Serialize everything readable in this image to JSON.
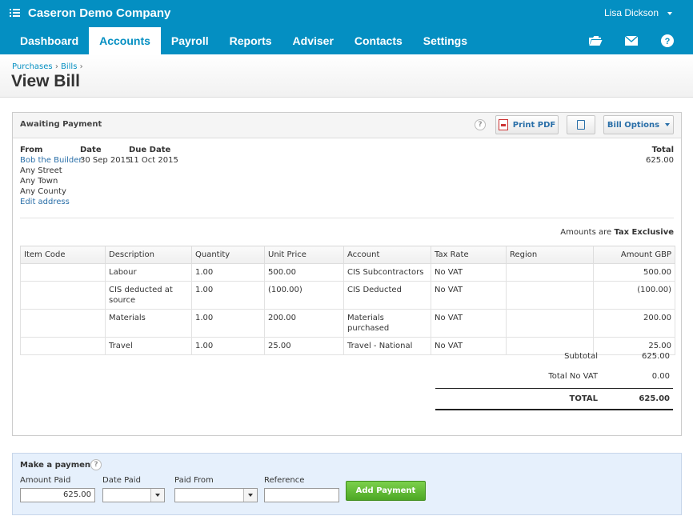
{
  "org": {
    "name": "Caseron Demo Company"
  },
  "user": {
    "name": "Lisa Dickson"
  },
  "nav": [
    {
      "label": "Dashboard"
    },
    {
      "label": "Accounts"
    },
    {
      "label": "Payroll"
    },
    {
      "label": "Reports"
    },
    {
      "label": "Adviser"
    },
    {
      "label": "Contacts"
    },
    {
      "label": "Settings"
    }
  ],
  "nav_icons": [
    "folder-icon",
    "mail-icon",
    "help-icon"
  ],
  "breadcrumb": {
    "first": "Purchases",
    "second": "Bills"
  },
  "page_title": "View Bill",
  "bill": {
    "status": "Awaiting Payment",
    "print_pdf_label": "Print PDF",
    "bill_options_label": "Bill Options",
    "from_label": "From",
    "from_name": "Bob the Builder",
    "address": [
      "Any Street",
      "Any Town",
      "Any County"
    ],
    "edit_address_label": "Edit address",
    "date_label": "Date",
    "date": "30 Sep 2015",
    "due_date_label": "Due Date",
    "due_date": "11 Oct 2015",
    "total_label": "Total",
    "total": "625.00",
    "amounts_prefix": "Amounts are",
    "amounts_mode": "Tax Exclusive",
    "columns": [
      "Item Code",
      "Description",
      "Quantity",
      "Unit Price",
      "Account",
      "Tax Rate",
      "Region",
      "Amount GBP"
    ],
    "lines": [
      {
        "item_code": "",
        "description": "Labour",
        "quantity": "1.00",
        "unit_price": "500.00",
        "account": "CIS Subcontractors",
        "tax_rate": "No VAT",
        "region": "",
        "amount": "500.00"
      },
      {
        "item_code": "",
        "description": "CIS deducted at source",
        "quantity": "1.00",
        "unit_price": "(100.00)",
        "account": "CIS Deducted",
        "tax_rate": "No VAT",
        "region": "",
        "amount": "(100.00)"
      },
      {
        "item_code": "",
        "description": "Materials",
        "quantity": "1.00",
        "unit_price": "200.00",
        "account": "Materials purchased",
        "tax_rate": "No VAT",
        "region": "",
        "amount": "200.00"
      },
      {
        "item_code": "",
        "description": "Travel",
        "quantity": "1.00",
        "unit_price": "25.00",
        "account": "Travel - National",
        "tax_rate": "No VAT",
        "region": "",
        "amount": "25.00"
      }
    ],
    "subtotal_label": "Subtotal",
    "subtotal": "625.00",
    "vat_label": "Total No VAT",
    "vat": "0.00",
    "grand_total_label": "TOTAL",
    "grand_total": "625.00"
  },
  "payment": {
    "title": "Make a payment",
    "amount_label": "Amount Paid",
    "amount_value": "625.00",
    "date_label": "Date Paid",
    "date_value": "",
    "from_label": "Paid From",
    "from_value": "",
    "reference_label": "Reference",
    "reference_value": "",
    "button_label": "Add Payment"
  }
}
